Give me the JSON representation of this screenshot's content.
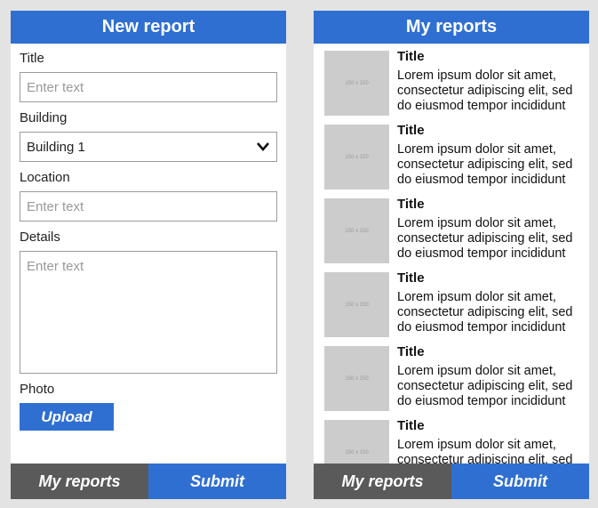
{
  "form": {
    "header": "New report",
    "title_label": "Title",
    "title_placeholder": "Enter text",
    "building_label": "Building",
    "building_value": "Building 1",
    "location_label": "Location",
    "location_placeholder": "Enter text",
    "details_label": "Details",
    "details_placeholder": "Enter text",
    "photo_label": "Photo",
    "upload_label": "Upload"
  },
  "footer": {
    "my_reports_label": "My reports",
    "submit_label": "Submit"
  },
  "reports": {
    "header": "My reports",
    "items": [
      {
        "thumb": "150 x 150",
        "title": "Title",
        "desc": "Lorem ipsum dolor sit amet, consectetur adipiscing elit, sed do eiusmod tempor incididunt"
      },
      {
        "thumb": "150 x 150",
        "title": "Title",
        "desc": "Lorem ipsum dolor sit amet, consectetur adipiscing elit, sed do eiusmod tempor incididunt"
      },
      {
        "thumb": "150 x 150",
        "title": "Title",
        "desc": "Lorem ipsum dolor sit amet, consectetur adipiscing elit, sed do eiusmod tempor incididunt"
      },
      {
        "thumb": "150 x 150",
        "title": "Title",
        "desc": "Lorem ipsum dolor sit amet, consectetur adipiscing elit, sed do eiusmod tempor incididunt"
      },
      {
        "thumb": "150 x 150",
        "title": "Title",
        "desc": "Lorem ipsum dolor sit amet, consectetur adipiscing elit, sed do eiusmod tempor incididunt"
      },
      {
        "thumb": "150 x 150",
        "title": "Title",
        "desc": "Lorem ipsum dolor sit amet, consectetur adipiscing elit, sed do eiusmod tempor incididunt"
      }
    ]
  },
  "colors": {
    "accent": "#2f6fd1",
    "dark_button": "#5a5a5a",
    "background": "#e3e3e3"
  }
}
